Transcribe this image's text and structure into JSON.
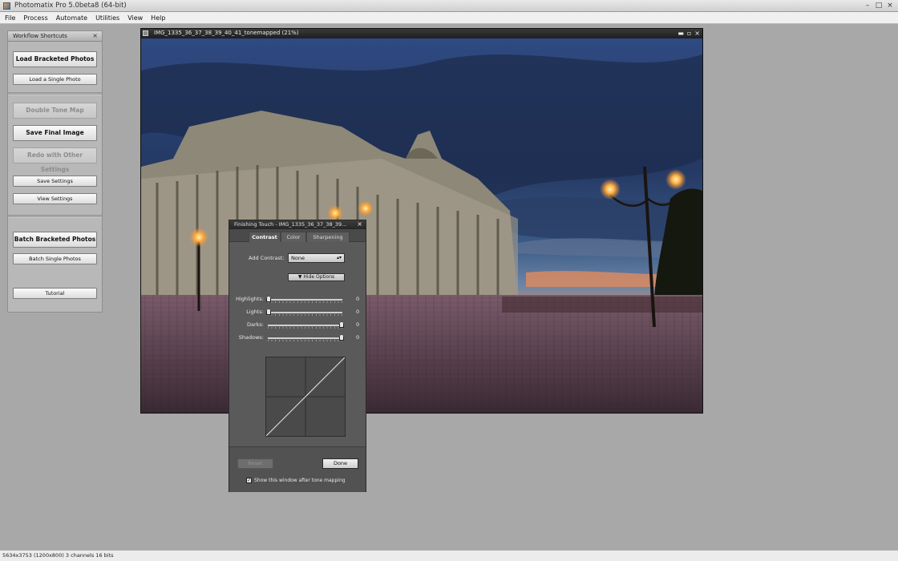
{
  "app": {
    "title": "Photomatix Pro 5.0beta8 (64-bit)",
    "controls": [
      "–",
      "□",
      "×"
    ]
  },
  "menu": [
    "File",
    "Process",
    "Automate",
    "Utilities",
    "View",
    "Help"
  ],
  "workflow": {
    "title": "Workflow Shortcuts",
    "close": "×",
    "load_bracketed": "Load Bracketed Photos",
    "load_single": "Load a Single Photo",
    "double_tone_map": "Double Tone Map",
    "save_final": "Save Final Image",
    "redo_other": "Redo with Other Settings",
    "save_settings": "Save Settings",
    "view_settings": "View Settings",
    "batch_bracketed": "Batch Bracketed Photos",
    "batch_single": "Batch Single Photos",
    "tutorial": "Tutorial"
  },
  "image_window": {
    "title": "IMG_1335_36_37_38_39_40_41_tonemapped (21%)",
    "controls": [
      "▬",
      "▫",
      "×"
    ]
  },
  "finishing_touch": {
    "title": "Finishing Touch - IMG_1335_36_37_38_39...",
    "close": "×",
    "tabs": [
      "Contrast",
      "Color",
      "Sharpening"
    ],
    "add_contrast_label": "Add Contrast:",
    "add_contrast_value": "None",
    "hide_options": "Hide Options",
    "sliders": [
      {
        "label": "Highlights:",
        "value": "0",
        "position": 0.0
      },
      {
        "label": "Lights:",
        "value": "0",
        "position": 0.0
      },
      {
        "label": "Darks:",
        "value": "0",
        "position": 1.0
      },
      {
        "label": "Shadows:",
        "value": "0",
        "position": 1.0
      }
    ],
    "reset": "Reset",
    "done": "Done",
    "show_after": "Show this window after tone mapping",
    "show_after_checked": true
  },
  "status": {
    "text": "5634x3753 (1200x800) 3 channels 16 bits"
  }
}
